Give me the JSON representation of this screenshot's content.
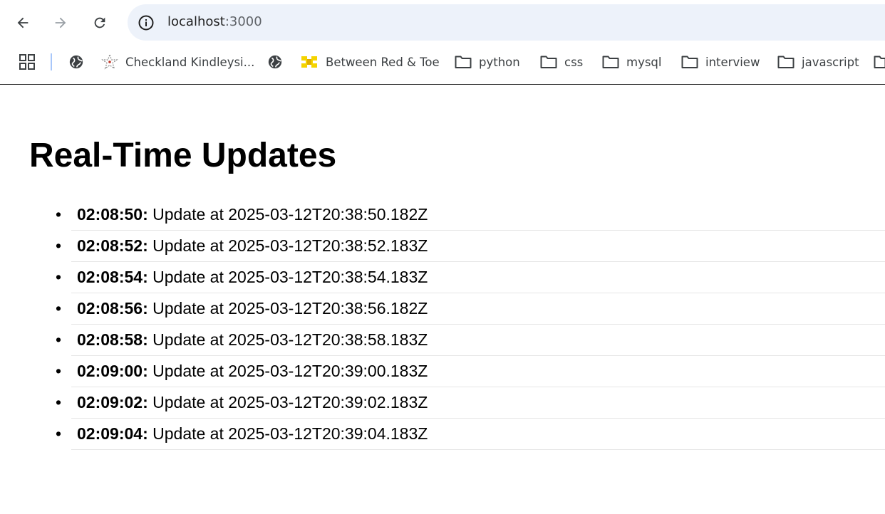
{
  "browser": {
    "url_host": "localhost",
    "url_port": ":3000"
  },
  "bookmarks": [
    {
      "label": "",
      "icon": "globe-icon"
    },
    {
      "label": "Checkland Kindleysi...",
      "icon": "star-logo-icon"
    },
    {
      "label": "",
      "icon": "globe-icon"
    },
    {
      "label": "Between Red & Toe",
      "icon": "yellow-logo-icon"
    },
    {
      "label": "python",
      "icon": "folder-icon"
    },
    {
      "label": "css",
      "icon": "folder-icon"
    },
    {
      "label": "mysql",
      "icon": "folder-icon"
    },
    {
      "label": "interview",
      "icon": "folder-icon"
    },
    {
      "label": "javascript",
      "icon": "folder-icon"
    }
  ],
  "page": {
    "title": "Real-Time Updates",
    "bullet": "•",
    "updates": [
      {
        "time": "02:08:50:",
        "text": " Update at 2025-03-12T20:38:50.182Z"
      },
      {
        "time": "02:08:52:",
        "text": " Update at 2025-03-12T20:38:52.183Z"
      },
      {
        "time": "02:08:54:",
        "text": " Update at 2025-03-12T20:38:54.183Z"
      },
      {
        "time": "02:08:56:",
        "text": " Update at 2025-03-12T20:38:56.182Z"
      },
      {
        "time": "02:08:58:",
        "text": " Update at 2025-03-12T20:38:58.183Z"
      },
      {
        "time": "02:09:00:",
        "text": " Update at 2025-03-12T20:39:00.183Z"
      },
      {
        "time": "02:09:02:",
        "text": " Update at 2025-03-12T20:39:02.183Z"
      },
      {
        "time": "02:09:04:",
        "text": " Update at 2025-03-12T20:39:04.183Z"
      }
    ]
  },
  "colors": {
    "omnibox_bg": "#edf2fa",
    "separator": "#a8c7fa",
    "folder_stroke": "#3c4043",
    "bookmark_logo_yellow": "#f5d400"
  }
}
